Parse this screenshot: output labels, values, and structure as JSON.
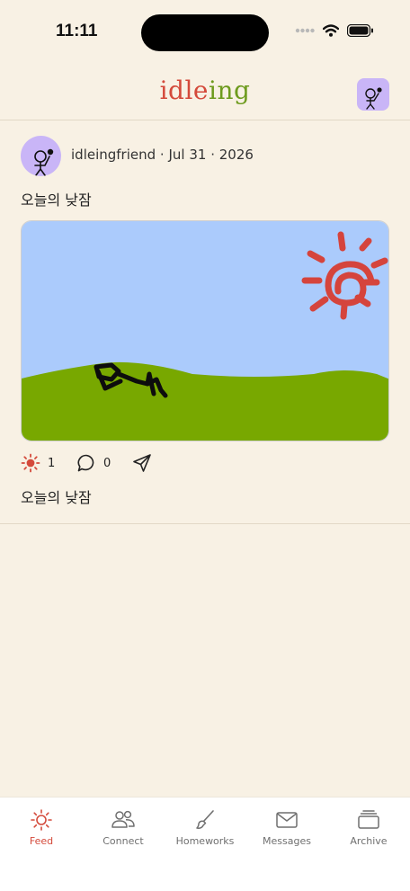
{
  "status_bar": {
    "time": "11:11"
  },
  "header": {
    "title_part1": "idle",
    "title_part2": "ing"
  },
  "post": {
    "author": "idleingfriend",
    "date": "Jul 31 · 2026",
    "title": "오늘의 낮잠",
    "caption": "오늘의 낮잠",
    "reactions": {
      "sun_count": "1",
      "comment_count": "0"
    }
  },
  "tabs": [
    {
      "label": "Feed",
      "icon": "sun-icon",
      "active": true
    },
    {
      "label": "Connect",
      "icon": "people-icon",
      "active": false
    },
    {
      "label": "Homeworks",
      "icon": "brush-icon",
      "active": false
    },
    {
      "label": "Messages",
      "icon": "envelope-icon",
      "active": false
    },
    {
      "label": "Archive",
      "icon": "archive-icon",
      "active": false
    }
  ],
  "colors": {
    "background": "#f8f1e4",
    "accent_red": "#d44a3b",
    "accent_green": "#6e9b1e",
    "avatar_purple": "#c9b5f7",
    "sky_blue": "#abcbfc",
    "grass_green": "#78a800"
  }
}
